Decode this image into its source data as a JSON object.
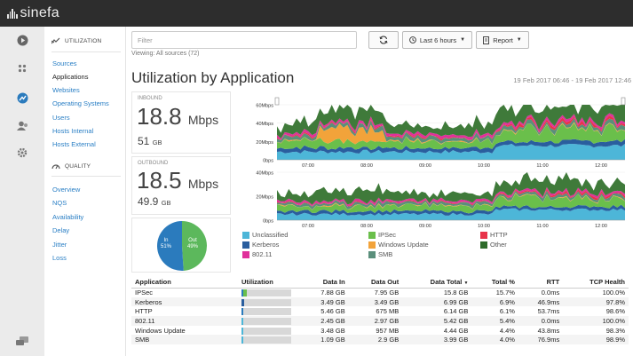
{
  "app": {
    "name": "sinefa"
  },
  "nav": {
    "utilization_heading": "UTILIZATION",
    "utilization_items": [
      {
        "label": "Sources",
        "active": false
      },
      {
        "label": "Applications",
        "active": true
      },
      {
        "label": "Websites",
        "active": false
      },
      {
        "label": "Operating Systems",
        "active": false
      },
      {
        "label": "Users",
        "active": false
      },
      {
        "label": "Hosts Internal",
        "active": false
      },
      {
        "label": "Hosts External",
        "active": false
      }
    ],
    "quality_heading": "QUALITY",
    "quality_items": [
      {
        "label": "Overview"
      },
      {
        "label": "NQS"
      },
      {
        "label": "Availability"
      },
      {
        "label": "Delay"
      },
      {
        "label": "Jitter"
      },
      {
        "label": "Loss"
      }
    ]
  },
  "toolbar": {
    "filter_placeholder": "Filter",
    "viewing": "Viewing: All sources (72)",
    "time_label": "Last 6 hours",
    "report_label": "Report"
  },
  "page": {
    "title": "Utilization by Application",
    "date_range": "19 Feb 2017 06:46 - 19 Feb 2017 12:46"
  },
  "inbound": {
    "label": "INBOUND",
    "rate_value": "18.8",
    "rate_unit": "Mbps",
    "total_value": "51",
    "total_unit": "GB"
  },
  "outbound": {
    "label": "OUTBOUND",
    "rate_value": "18.5",
    "rate_unit": "Mbps",
    "total_value": "49.9",
    "total_unit": "GB"
  },
  "pie": {
    "in_label": "In",
    "in_pct": "51%",
    "out_label": "Out",
    "out_pct": "49%",
    "in_fraction": 0.51,
    "in_color": "#2b7bbd",
    "out_color": "#5cb85c"
  },
  "chart_data": [
    {
      "type": "area",
      "title": "Inbound",
      "x": [
        "07:00",
        "08:00",
        "09:00",
        "10:00",
        "11:00",
        "12:00"
      ],
      "y_ticks": [
        "60Mbps",
        "40Mbps",
        "20Mbps",
        "0bps"
      ],
      "ylim": [
        0,
        60
      ],
      "stacked": true,
      "series_colors": {
        "Unclassified": "#4db6d8",
        "IPSec": "#6abf4b",
        "Kerberos": "#2a5e9e",
        "Windows Update": "#f2a33a",
        "SMB": "#5a8f7b",
        "HTTP": "#e8344a",
        "802.11": "#e0309a",
        "Other": "#3f7a3a"
      }
    },
    {
      "type": "area",
      "title": "Outbound",
      "x": [
        "07:00",
        "08:00",
        "09:00",
        "10:00",
        "11:00",
        "12:00"
      ],
      "y_ticks": [
        "40Mbps",
        "20Mbps",
        "0bps"
      ],
      "ylim": [
        0,
        40
      ],
      "stacked": true
    }
  ],
  "legend": [
    {
      "label": "Unclassified",
      "color": "#4db6d8"
    },
    {
      "label": "Kerberos",
      "color": "#2a5e9e"
    },
    {
      "label": "802.11",
      "color": "#e0309a"
    },
    {
      "label": "IPSec",
      "color": "#6abf4b"
    },
    {
      "label": "Windows Update",
      "color": "#f2a33a"
    },
    {
      "label": "SMB",
      "color": "#5a8f7b"
    },
    {
      "label": "HTTP",
      "color": "#e8344a"
    },
    {
      "label": "Other",
      "color": "#2e6b2a"
    }
  ],
  "table": {
    "headers": {
      "application": "Application",
      "utilization": "Utilization",
      "data_in": "Data In",
      "data_out": "Data Out",
      "data_total": "Data Total",
      "total_pct": "Total %",
      "rtt": "RTT",
      "tcp_health": "TCP Health"
    },
    "rows": [
      {
        "application": "IPSec",
        "data_in": "7.88 GB",
        "data_out": "7.95 GB",
        "data_total": "15.8 GB",
        "total_pct": "15.7%",
        "rtt": "0.0ms",
        "tcp_health": "100.0%",
        "util_fraction": 0.157,
        "util_color": "#6abf4b"
      },
      {
        "application": "Kerberos",
        "data_in": "3.49 GB",
        "data_out": "3.49 GB",
        "data_total": "6.99 GB",
        "total_pct": "6.9%",
        "rtt": "46.9ms",
        "tcp_health": "97.8%",
        "util_fraction": 0.069,
        "util_color": "#2a5e9e"
      },
      {
        "application": "HTTP",
        "data_in": "5.46 GB",
        "data_out": "675 MB",
        "data_total": "6.14 GB",
        "total_pct": "6.1%",
        "rtt": "53.7ms",
        "tcp_health": "98.6%",
        "util_fraction": 0.061,
        "util_color": "#2b7bbd"
      },
      {
        "application": "802.11",
        "data_in": "2.45 GB",
        "data_out": "2.97 GB",
        "data_total": "5.42 GB",
        "total_pct": "5.4%",
        "rtt": "0.0ms",
        "tcp_health": "100.0%",
        "util_fraction": 0.054,
        "util_color": "#4db6d8"
      },
      {
        "application": "Windows Update",
        "data_in": "3.48 GB",
        "data_out": "957 MB",
        "data_total": "4.44 GB",
        "total_pct": "4.4%",
        "rtt": "43.8ms",
        "tcp_health": "98.3%",
        "util_fraction": 0.044,
        "util_color": "#4db6d8"
      },
      {
        "application": "SMB",
        "data_in": "1.09 GB",
        "data_out": "2.9 GB",
        "data_total": "3.99 GB",
        "total_pct": "4.0%",
        "rtt": "76.9ms",
        "tcp_health": "98.9%",
        "util_fraction": 0.04,
        "util_color": "#4db6d8"
      }
    ]
  }
}
